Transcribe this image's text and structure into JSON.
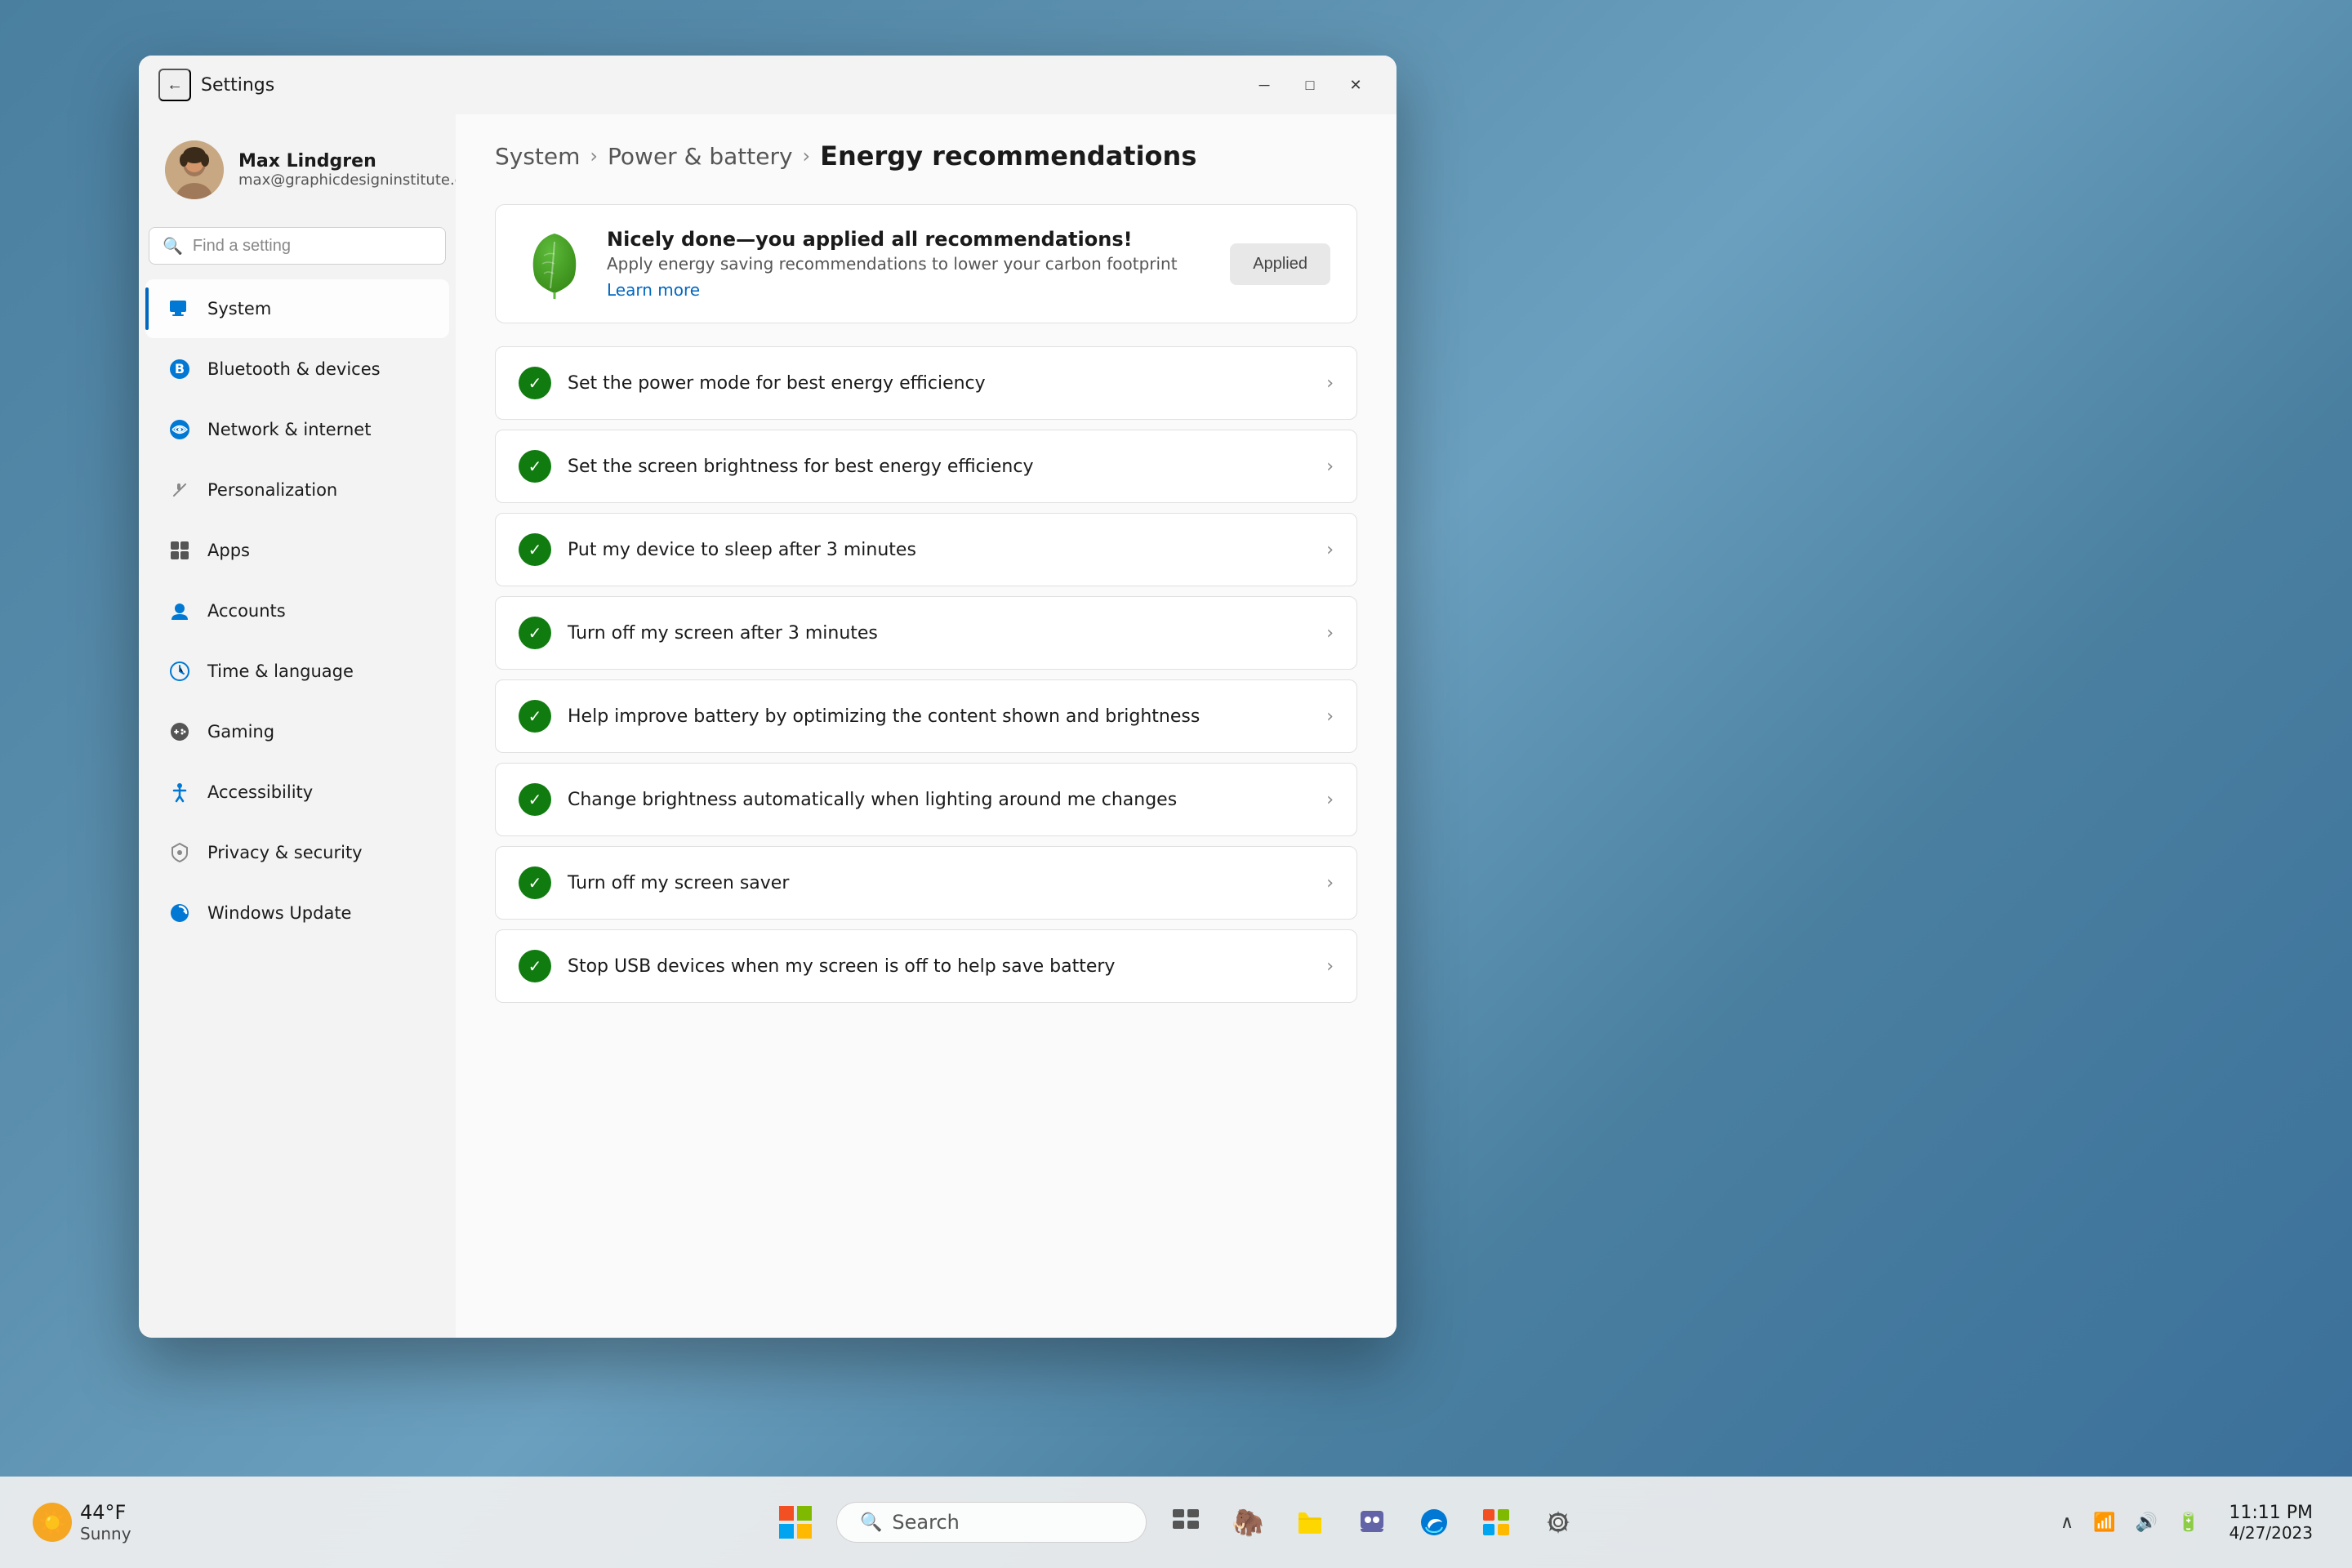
{
  "desktop": {
    "background": "#5b8fad"
  },
  "taskbar": {
    "weather": {
      "temp": "44°F",
      "condition": "Sunny"
    },
    "search_placeholder": "Search",
    "clock": {
      "time": "11:11 PM",
      "date": "4/27/2023"
    },
    "apps": [
      {
        "name": "windows-start",
        "icon": "⊞"
      },
      {
        "name": "search",
        "icon": "🔍"
      },
      {
        "name": "taskview",
        "icon": "🗂"
      },
      {
        "name": "browser-app",
        "icon": "🦣"
      },
      {
        "name": "file-explorer",
        "icon": "📁"
      },
      {
        "name": "chat-app",
        "icon": "💬"
      },
      {
        "name": "edge-browser",
        "icon": "🌐"
      },
      {
        "name": "microsoft-store",
        "icon": "🛍"
      },
      {
        "name": "settings-app",
        "icon": "⚙"
      }
    ]
  },
  "window": {
    "title": "Settings",
    "back_label": "←",
    "minimize_label": "─",
    "maximize_label": "□",
    "close_label": "✕"
  },
  "user": {
    "name": "Max Lindgren",
    "email": "max@graphicdesigninstitute.com"
  },
  "search": {
    "placeholder": "Find a setting"
  },
  "breadcrumb": {
    "system": "System",
    "power_battery": "Power & battery",
    "current": "Energy recommendations"
  },
  "sidebar": {
    "items": [
      {
        "id": "system",
        "label": "System",
        "icon": "💻",
        "active": true
      },
      {
        "id": "bluetooth",
        "label": "Bluetooth & devices",
        "icon": "bluetooth"
      },
      {
        "id": "network",
        "label": "Network & internet",
        "icon": "network"
      },
      {
        "id": "personalization",
        "label": "Personalization",
        "icon": "personalization"
      },
      {
        "id": "apps",
        "label": "Apps",
        "icon": "apps"
      },
      {
        "id": "accounts",
        "label": "Accounts",
        "icon": "accounts"
      },
      {
        "id": "time",
        "label": "Time & language",
        "icon": "time"
      },
      {
        "id": "gaming",
        "label": "Gaming",
        "icon": "gaming"
      },
      {
        "id": "accessibility",
        "label": "Accessibility",
        "icon": "accessibility"
      },
      {
        "id": "privacy",
        "label": "Privacy & security",
        "icon": "privacy"
      },
      {
        "id": "update",
        "label": "Windows Update",
        "icon": "update"
      }
    ]
  },
  "banner": {
    "title": "Nicely done—you applied all recommendations!",
    "subtitle": "Apply energy saving recommendations to lower your carbon footprint",
    "link": "Learn more",
    "button": "Applied"
  },
  "recommendations": [
    {
      "id": "rec1",
      "label": "Set the power mode for best energy efficiency",
      "applied": true
    },
    {
      "id": "rec2",
      "label": "Set the screen brightness for best energy efficiency",
      "applied": true
    },
    {
      "id": "rec3",
      "label": "Put my device to sleep after 3 minutes",
      "applied": true
    },
    {
      "id": "rec4",
      "label": "Turn off my screen after 3 minutes",
      "applied": true
    },
    {
      "id": "rec5",
      "label": "Help improve battery by optimizing the content shown and brightness",
      "applied": true
    },
    {
      "id": "rec6",
      "label": "Change brightness automatically when lighting around me changes",
      "applied": true
    },
    {
      "id": "rec7",
      "label": "Turn off my screen saver",
      "applied": true
    },
    {
      "id": "rec8",
      "label": "Stop USB devices when my screen is off to help save battery",
      "applied": true
    }
  ]
}
